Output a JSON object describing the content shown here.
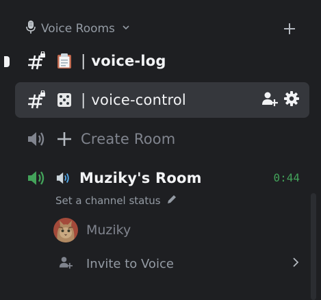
{
  "category": {
    "title": "Voice Rooms",
    "chevron": "chevron-down-icon",
    "add_icon": "plus-icon"
  },
  "channels": [
    {
      "name": "voice-log",
      "type": "text-locked",
      "emoji": "clipboard-emoji",
      "unread": true,
      "selected": false
    },
    {
      "name": "voice-control",
      "type": "text-locked",
      "emoji": "dice-emoji",
      "unread": false,
      "selected": true
    },
    {
      "name": "Create Room",
      "type": "voice",
      "emoji": "plus-icon",
      "muted": true
    },
    {
      "name": "Muziky's Room",
      "type": "voice-active",
      "emoji": "speaker-emoji",
      "elapsed": "0:44"
    }
  ],
  "separator": "|",
  "channel_actions": {
    "invite_icon": "add-member-icon",
    "settings_icon": "gear-icon"
  },
  "voice_room": {
    "status_prompt": "Set a channel status",
    "user": {
      "name": "Muziky",
      "avatar": "cat-avatar"
    },
    "invite_label": "Invite to Voice"
  },
  "colors": {
    "background": "#1e1f22",
    "selected_row": "#35373c",
    "voice_green": "#43a25a",
    "muted_text": "#80848e"
  }
}
